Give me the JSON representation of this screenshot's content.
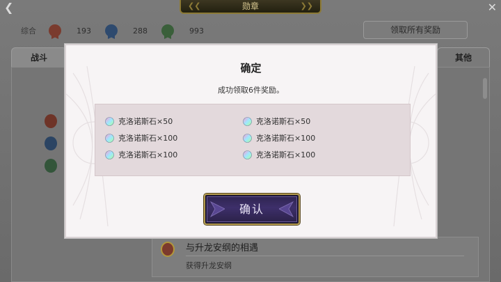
{
  "header": {
    "title": "勋章",
    "back_icon": "chevron-left-icon",
    "close_icon": "close-icon"
  },
  "stats": {
    "label": "综合",
    "items": [
      {
        "icon": "red-medal-icon",
        "value": "193",
        "color": "#7a3b2e"
      },
      {
        "icon": "blue-medal-icon",
        "value": "288",
        "color": "#2e4a6e"
      },
      {
        "icon": "green-medal-icon",
        "value": "993",
        "color": "#3a5f3a"
      }
    ]
  },
  "claim_all_label": "领取所有奖励",
  "tabs": {
    "battle": "战斗",
    "other": "其他"
  },
  "background_row": {
    "title": "与升龙安纲的相遇",
    "subtitle": "获得升龙安纲"
  },
  "dialog": {
    "title": "确定",
    "message": "成功领取6件奖励。",
    "rewards": [
      {
        "name": "克洛诺斯石×50"
      },
      {
        "name": "克洛诺斯石×50"
      },
      {
        "name": "克洛诺斯石×100"
      },
      {
        "name": "克洛诺斯石×100"
      },
      {
        "name": "克洛诺斯石×100"
      },
      {
        "name": "克洛诺斯石×100"
      }
    ],
    "confirm_label": "确认"
  },
  "colors": {
    "confirm_button": "#3d2f6a",
    "button_border": "#b39a4c",
    "reward_box": "#e3d9dc"
  }
}
